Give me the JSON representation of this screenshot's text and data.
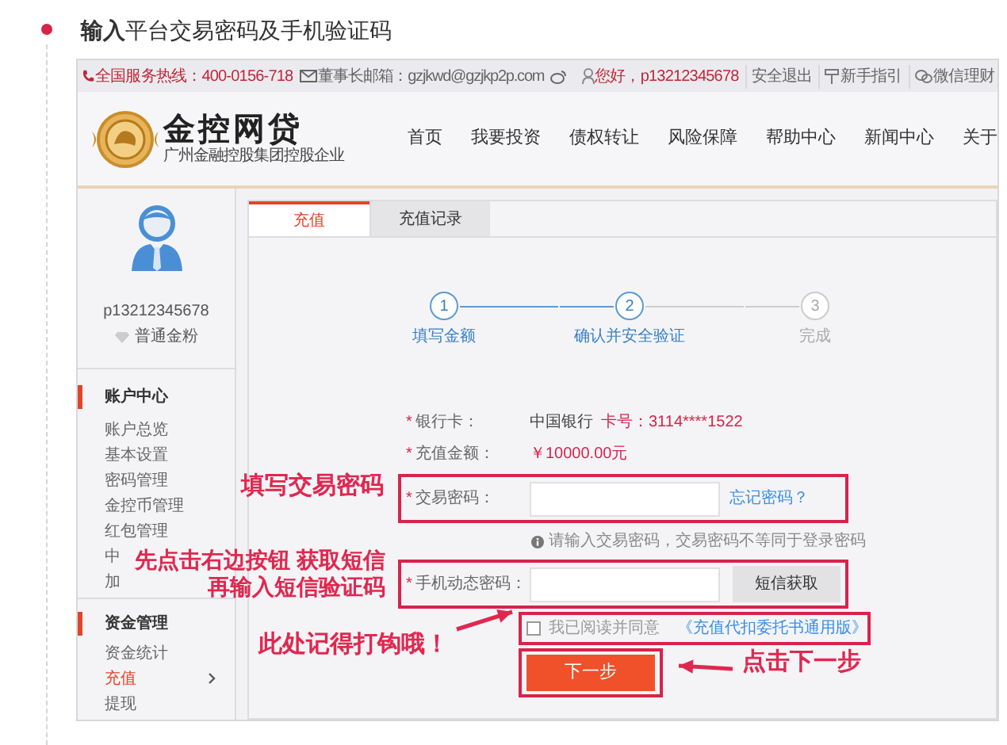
{
  "heading": "**输入**平台交易密码及手机验证码",
  "top_bar": {
    "hotline": "全国服务热线：400-0156-718",
    "email": "董事长邮箱：gzjkwd@gzjkp2p.com",
    "greeting": "您好，p13212345678",
    "links": [
      {
        "kind": "plain",
        "label": "安全退出"
      },
      {
        "kind": "guide",
        "label": "新手指引"
      },
      {
        "kind": "wechat",
        "label": "微信理财"
      }
    ]
  },
  "logo": {
    "name": "金控网贷",
    "tagline": "广州金融控股集团控股企业"
  },
  "nav": [
    "首页",
    "我要投资",
    "债权转让",
    "风险保障",
    "帮助中心",
    "新闻中心",
    "关于"
  ],
  "user": {
    "name": "p13212345678",
    "level": "普通金粉"
  },
  "sidebar": [
    {
      "title": "账户中心",
      "items": [
        {
          "label": "账户总览",
          "selected": false
        },
        {
          "label": "基本设置",
          "selected": false
        },
        {
          "label": "密码管理",
          "selected": false
        },
        {
          "label": "金控币管理",
          "selected": false
        },
        {
          "label": "红包管理",
          "selected": false
        },
        {
          "label": "中",
          "selected": false
        },
        {
          "label": "加",
          "selected": false
        }
      ]
    },
    {
      "title": "资金管理",
      "items": [
        {
          "label": "资金统计",
          "selected": false
        },
        {
          "label": "充值",
          "selected": true
        },
        {
          "label": "提现",
          "selected": false
        }
      ]
    }
  ],
  "tabs": [
    {
      "label": "充值",
      "selected": true
    },
    {
      "label": "充值记录",
      "selected": false
    }
  ],
  "steps": [
    {
      "number": "1",
      "label": "填写金额",
      "active": true
    },
    {
      "number": "2",
      "label": "确认并安全验证",
      "active": true
    },
    {
      "number": "3",
      "label": "完成",
      "active": false
    }
  ],
  "form": {
    "bank_card": {
      "mark": "*",
      "label": "银行卡：",
      "bank": "中国银行",
      "card_no": "卡号：3114****1522"
    },
    "amount": {
      "mark": "*",
      "label": "充值金额：",
      "value": "￥10000.00元"
    },
    "trade_password": {
      "mark": "*",
      "label": "交易密码：",
      "link": "忘记密码？",
      "hint": "请输入交易密码，交易密码不等同于登录密码"
    },
    "sms_code": {
      "mark": "*",
      "label": "手机动态密码：",
      "button": "短信获取"
    },
    "agreement": {
      "checked": false,
      "text": "我已阅读并同意",
      "link": "《充值代扣委托书通用版》"
    },
    "submit": "下一步"
  },
  "annotations": [
    "填写交易密码",
    "先点击右边按钮 获取短信",
    "再输入短信验证码",
    "此处记得打钩哦！",
    "点击下一步"
  ]
}
